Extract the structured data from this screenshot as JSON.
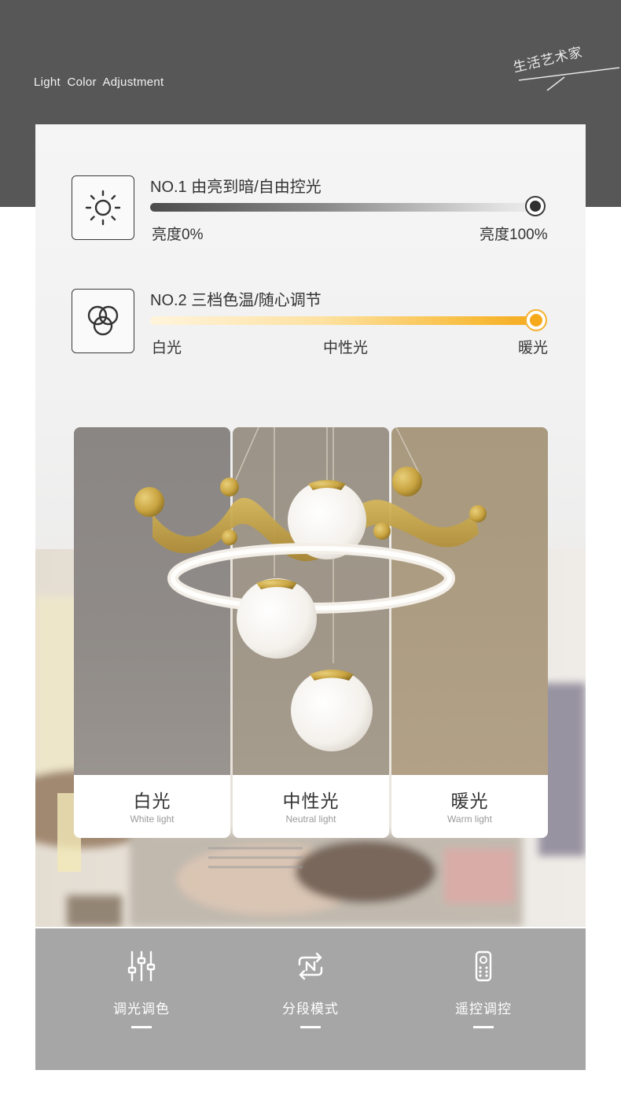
{
  "header": {
    "title": "Light  Color  Adjustment",
    "brand": "生活艺术家"
  },
  "features": [
    {
      "title": "NO.1  由亮到暗/自由控光",
      "icon": "brightness-icon",
      "scale_labels": [
        "亮度0%",
        "亮度100%"
      ]
    },
    {
      "title": "NO.2  三档色温/随心调节",
      "icon": "color-circles-icon",
      "scale_labels": [
        "白光",
        "中性光",
        "暖光"
      ]
    }
  ],
  "modes": [
    {
      "cn": "白光",
      "en": "White light"
    },
    {
      "cn": "中性光",
      "en": "Neutral light"
    },
    {
      "cn": "暖光",
      "en": "Warm light"
    }
  ],
  "bottom_features": [
    {
      "label": "调光调色",
      "icon": "sliders-icon"
    },
    {
      "label": "分段模式",
      "icon": "cycle-mode-icon"
    },
    {
      "label": "遥控调控",
      "icon": "remote-control-icon"
    }
  ],
  "colors": {
    "band": "#575757",
    "warm_accent": "#f6a91a",
    "bottom_band": "#a6a6a6"
  }
}
